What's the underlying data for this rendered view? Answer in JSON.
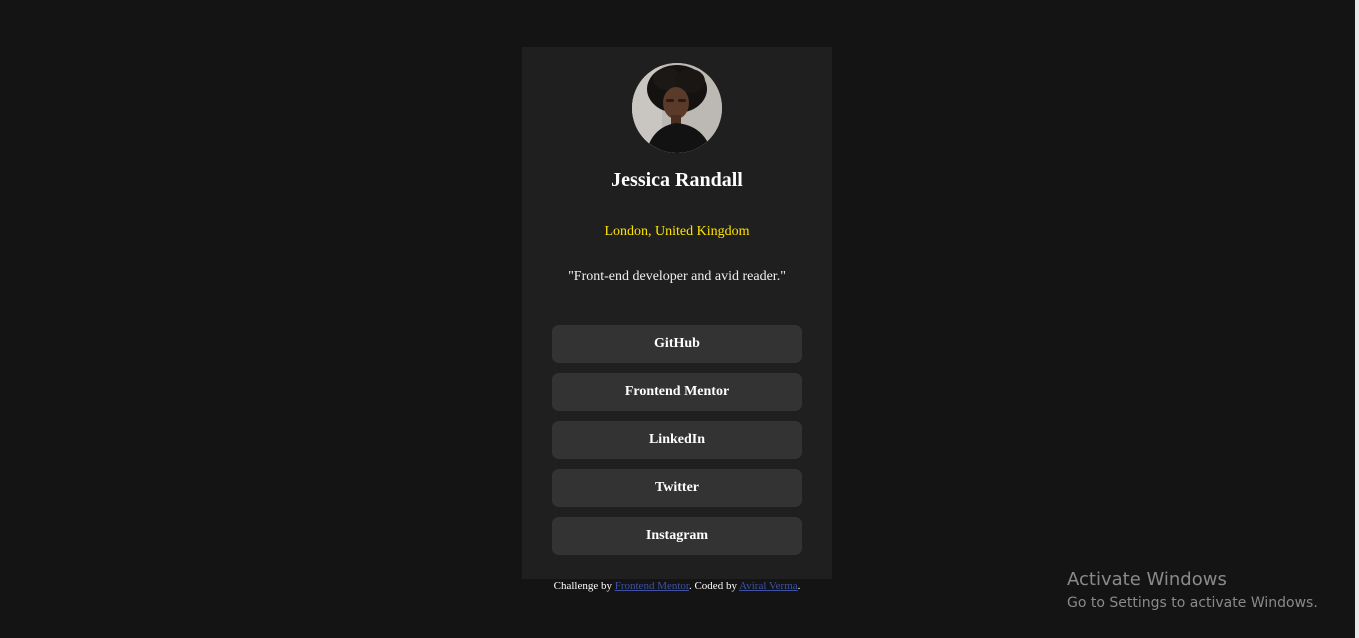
{
  "profile": {
    "name": "Jessica Randall",
    "location": "London, United Kingdom",
    "bio": "\"Front-end developer and avid reader.\""
  },
  "links": [
    {
      "label": "GitHub"
    },
    {
      "label": "Frontend Mentor"
    },
    {
      "label": "LinkedIn"
    },
    {
      "label": "Twitter"
    },
    {
      "label": "Instagram"
    }
  ],
  "footer": {
    "prefix": "Challenge by ",
    "challenge_link": "Frontend Mentor",
    "middle": ". Coded by ",
    "author_link": "Aviral Verma",
    "suffix": "."
  },
  "watermark": {
    "title": "Activate Windows",
    "subtitle": "Go to Settings to activate Windows."
  },
  "colors": {
    "page_bg": "#141414",
    "card_bg": "#1f1f1f",
    "button_bg": "#333333",
    "accent": "#ffe400",
    "footer_link": "#3e52a3"
  }
}
